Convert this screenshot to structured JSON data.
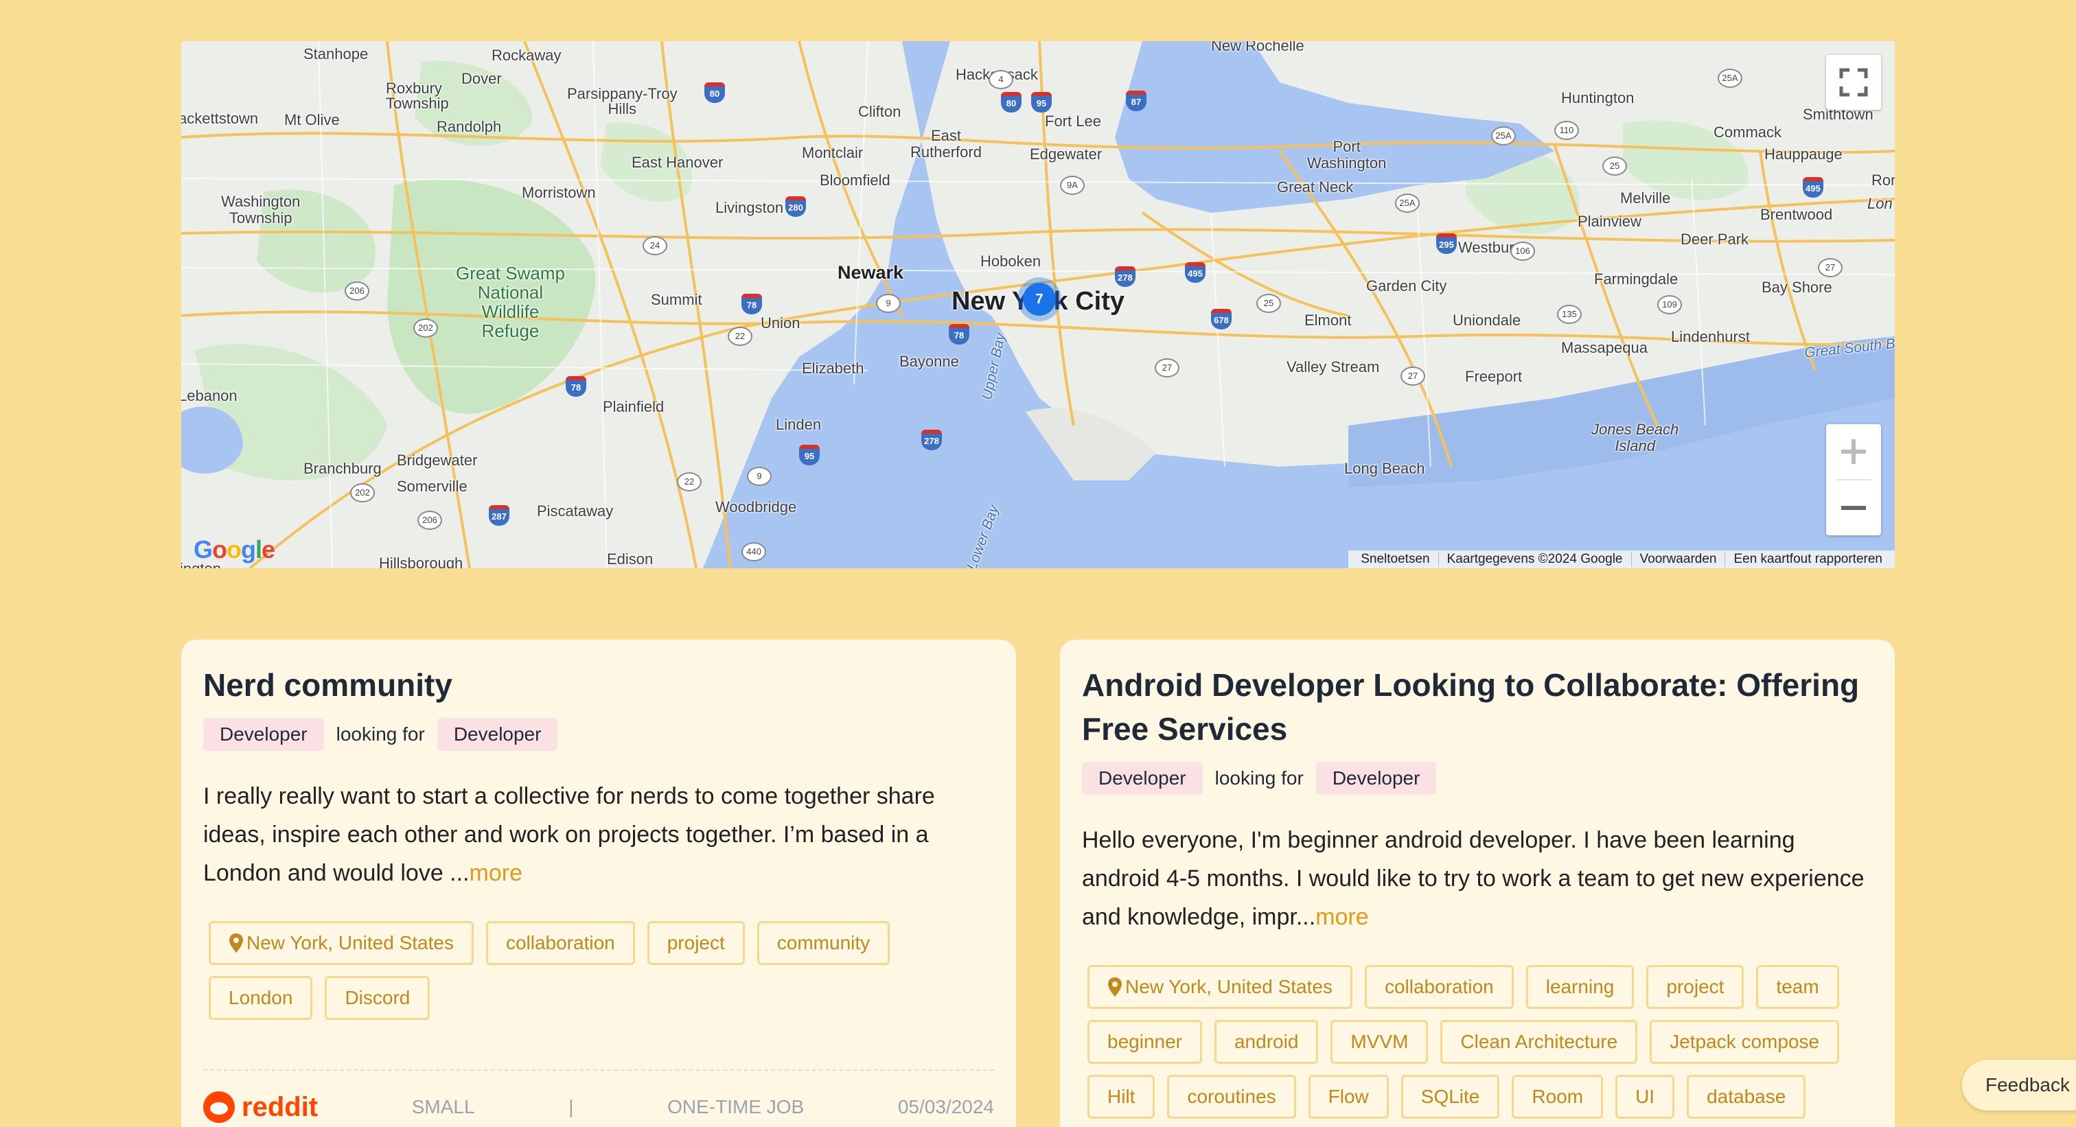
{
  "map": {
    "places": {
      "stanhope": "Stanhope",
      "rockaway": "Rockaway",
      "dover": "Dover",
      "roxbury": "Roxbury\nTownship",
      "mt_olive": "Mt Olive",
      "randolph": "Randolph",
      "parsippany": "Parsippany-Troy\nHills",
      "clifton": "Clifton",
      "hackensack": "Hackensack",
      "fort_lee": "Fort Lee",
      "new_rochelle": "New Rochelle",
      "huntington": "Huntington",
      "smithtown": "Smithtown",
      "commack": "Commack",
      "hauppauge": "Hauppauge",
      "port_washington": "Port\nWashington",
      "great_neck": "Great Neck",
      "melville": "Melville",
      "brentwood": "Brentwood",
      "plainview": "Plainview",
      "deer_park": "Deer Park",
      "washington_twp": "Washington\nTownship",
      "morristown": "Morristown",
      "east_hanover": "East Hanover",
      "montclair": "Montclair",
      "bloomfield": "Bloomfield",
      "east_rutherford": "East\nRutherford",
      "edgewater": "Edgewater",
      "livingston": "Livingston",
      "newark": "Newark",
      "hoboken": "Hoboken",
      "nyc": "New York City",
      "westbury": "Westbury",
      "farmingdale": "Farmingdale",
      "bay_shore": "Bay Shore",
      "garden_city": "Garden City",
      "elmont": "Elmont",
      "uniondale": "Uniondale",
      "massapequa": "Massapequa",
      "lindenhurst": "Lindenhurst",
      "summit": "Summit",
      "union": "Union",
      "elizabeth": "Elizabeth",
      "bayonne": "Bayonne",
      "valley_stream": "Valley Stream",
      "freeport": "Freeport",
      "lebanon": "Lebanon",
      "plainfield": "Plainfield",
      "linden": "Linden",
      "jones_beach": "Jones Beach\nIsland",
      "long_beach": "Long Beach",
      "branchburg": "Branchburg",
      "bridgewater": "Bridgewater",
      "somerville": "Somerville",
      "piscataway": "Piscataway",
      "woodbridge": "Woodbridge",
      "edison": "Edison",
      "hillsborough": "Hillsborough",
      "kettlestown": "ackettstown",
      "great_swamp": "Great Swamp\nNational\nWildlife\nRefuge",
      "upper_bay": "Upper Bay",
      "lower_bay": "Lower Bay",
      "great_south_bay": "Great South B",
      "lon": "Lon",
      "ron": "Ron",
      "ington": "ington"
    },
    "cluster_count": "7",
    "google_logo": "Google",
    "attribution": [
      "Sneltoetsen",
      "Kaartgegevens ©2024 Google",
      "Voorwaarden",
      "Een kaartfout rapporteren"
    ]
  },
  "cards": [
    {
      "title": "Nerd community",
      "role_from": "Developer",
      "looking_for": "looking for",
      "role_to": "Developer",
      "description": "I really really want to start a collective for nerds to come together share ideas, inspire each other and work on projects together. I’m based in a London and would love ...",
      "more": "more",
      "tags": [
        "New York, United States",
        "collaboration",
        "project",
        "community",
        "London",
        "Discord"
      ],
      "source": "reddit",
      "size": "SMALL",
      "separator": "|",
      "job_type": "ONE-TIME JOB",
      "date": "05/03/2024"
    },
    {
      "title": "Android Developer Looking to Collaborate: Offering Free Services",
      "role_from": "Developer",
      "looking_for": "looking for",
      "role_to": "Developer",
      "description": "Hello everyone, I'm beginner android developer. I have been learning android 4-5 months. I would like to try to work a team to get new experience and knowledge, impr...",
      "more": "more",
      "tags": [
        "New York, United States",
        "collaboration",
        "learning",
        "project",
        "team",
        "beginner",
        "android",
        "MVVM",
        "Clean Architecture",
        "Jetpack compose",
        "Hilt",
        "coroutines",
        "Flow",
        "SQLite",
        "Room",
        "UI",
        "database"
      ]
    }
  ],
  "feedback_label": "Feedback",
  "colors": {
    "page_bg": "#f8dd92",
    "card_bg": "#fef7e3",
    "accent": "#e19a1a",
    "role_tag_bg": "#fbe1e3",
    "reddit": "#ff4500"
  }
}
